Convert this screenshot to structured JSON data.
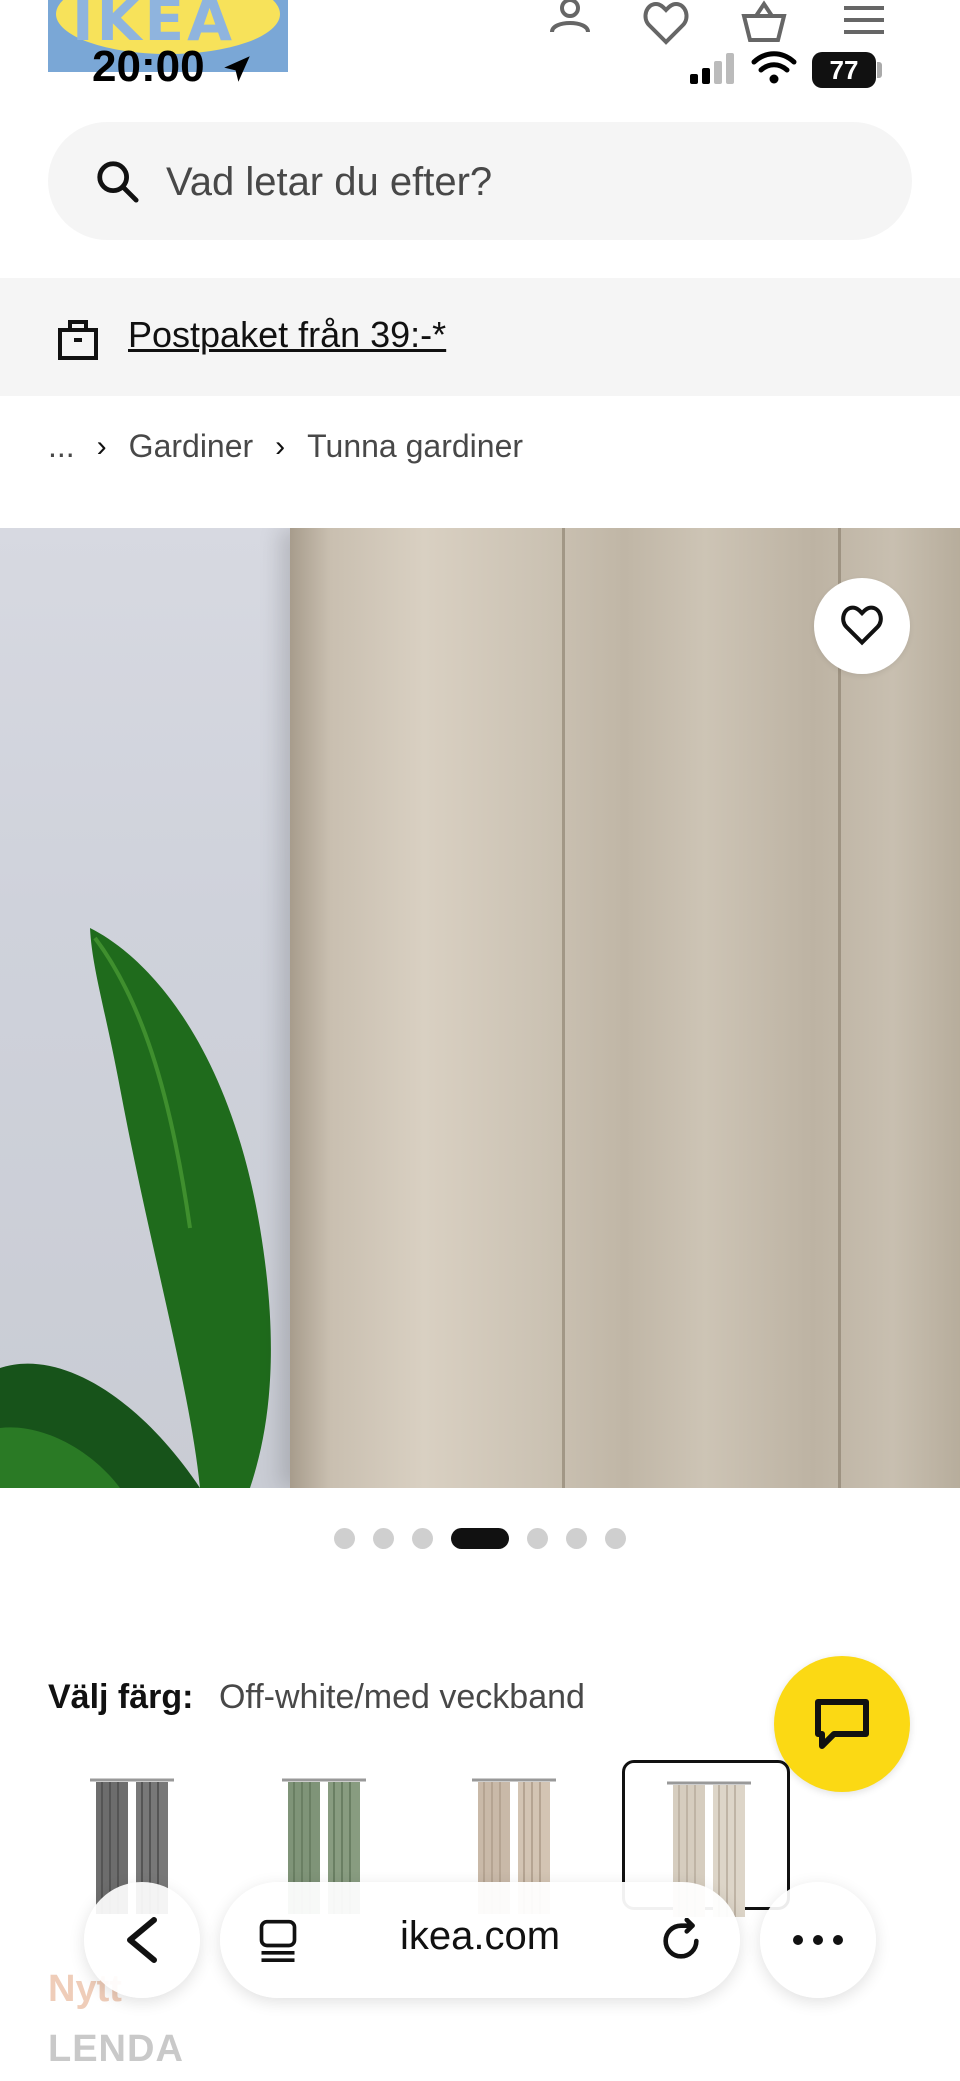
{
  "status_bar": {
    "time": "20:00",
    "battery": "77"
  },
  "header": {
    "logo_text": "IKEA",
    "icons": [
      "profile-icon",
      "heart-icon",
      "basket-icon",
      "menu-icon"
    ]
  },
  "search": {
    "placeholder": "Vad letar du efter?"
  },
  "promo": {
    "link_text": "Postpaket från 39:-*"
  },
  "breadcrumb": {
    "ellipsis": "...",
    "items": [
      "Gardiner",
      "Tunna gardiner"
    ]
  },
  "gallery": {
    "slide_count": 7,
    "active_index": 3
  },
  "color_picker": {
    "label": "Välj färg:",
    "value": "Off-white/med veckband",
    "swatches": [
      "grey",
      "green",
      "beige",
      "off-white"
    ],
    "selected_index": 3
  },
  "product": {
    "badge": "Nytt",
    "name": "LENDA"
  },
  "browser": {
    "url": "ikea.com"
  },
  "colors": {
    "ikea_yellow": "#fbd914",
    "ikea_blue": "#0058a3",
    "text": "#111111",
    "muted": "#484848"
  }
}
